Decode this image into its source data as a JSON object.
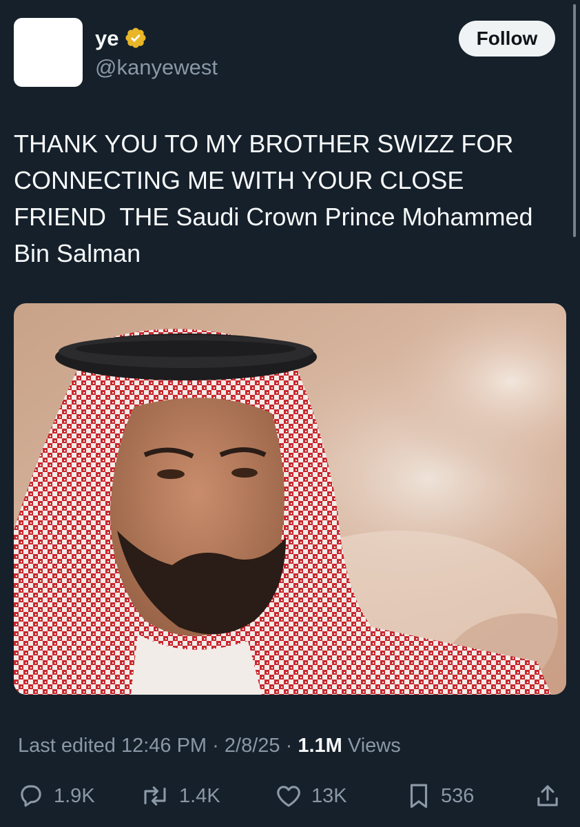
{
  "tweet": {
    "author": {
      "display_name": "ye",
      "handle": "@kanyewest",
      "verified_badge": "verified-gold-badge-icon",
      "avatar": "blank-white-avatar"
    },
    "follow_label": "Follow",
    "text": "THANK YOU TO MY BROTHER SWIZZ FOR\nCONNECTING ME WITH YOUR CLOSE\nFRIEND  THE Saudi Crown Prince Mohammed\nBin Salman",
    "media": {
      "type": "photo",
      "subject": "portrait-photo"
    },
    "meta": {
      "edited_label": "Last edited",
      "time": "12:46 PM",
      "separator": "·",
      "date": "2/8/25",
      "views_count": "1.1M",
      "views_label": "Views"
    },
    "actions": {
      "replies": "1.9K",
      "reposts": "1.4K",
      "likes": "13K",
      "bookmarks": "536"
    }
  },
  "colors": {
    "background": "#15202b",
    "text_primary": "#f7f9f9",
    "text_secondary": "#8b98a5",
    "verified_gold": "#e8b627",
    "follow_bg": "#eff3f4"
  }
}
